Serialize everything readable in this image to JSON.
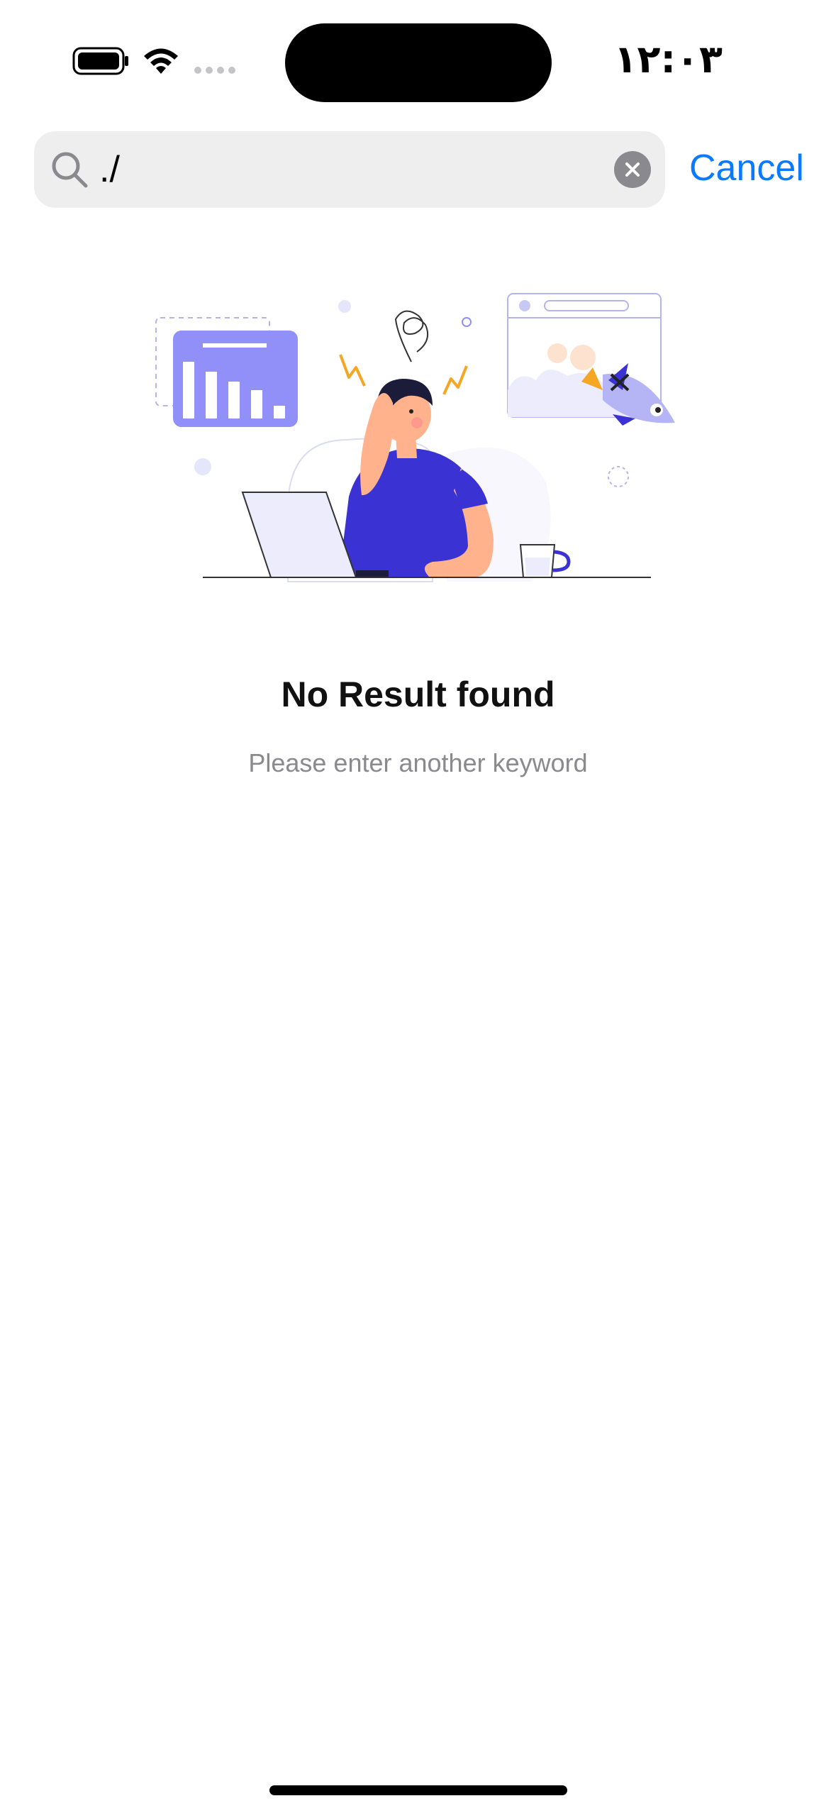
{
  "status_bar": {
    "time": "١٢:٠٣"
  },
  "search": {
    "value": "./",
    "cancel_label": "Cancel"
  },
  "empty_state": {
    "title": "No Result found",
    "subtitle": "Please enter another keyword"
  },
  "colors": {
    "accent": "#0a7aff",
    "illustration_primary": "#3b32d4",
    "illustration_light": "#9090f8"
  },
  "icons": [
    "battery-icon",
    "wifi-icon",
    "signal-icon",
    "search-icon",
    "clear-icon"
  ]
}
